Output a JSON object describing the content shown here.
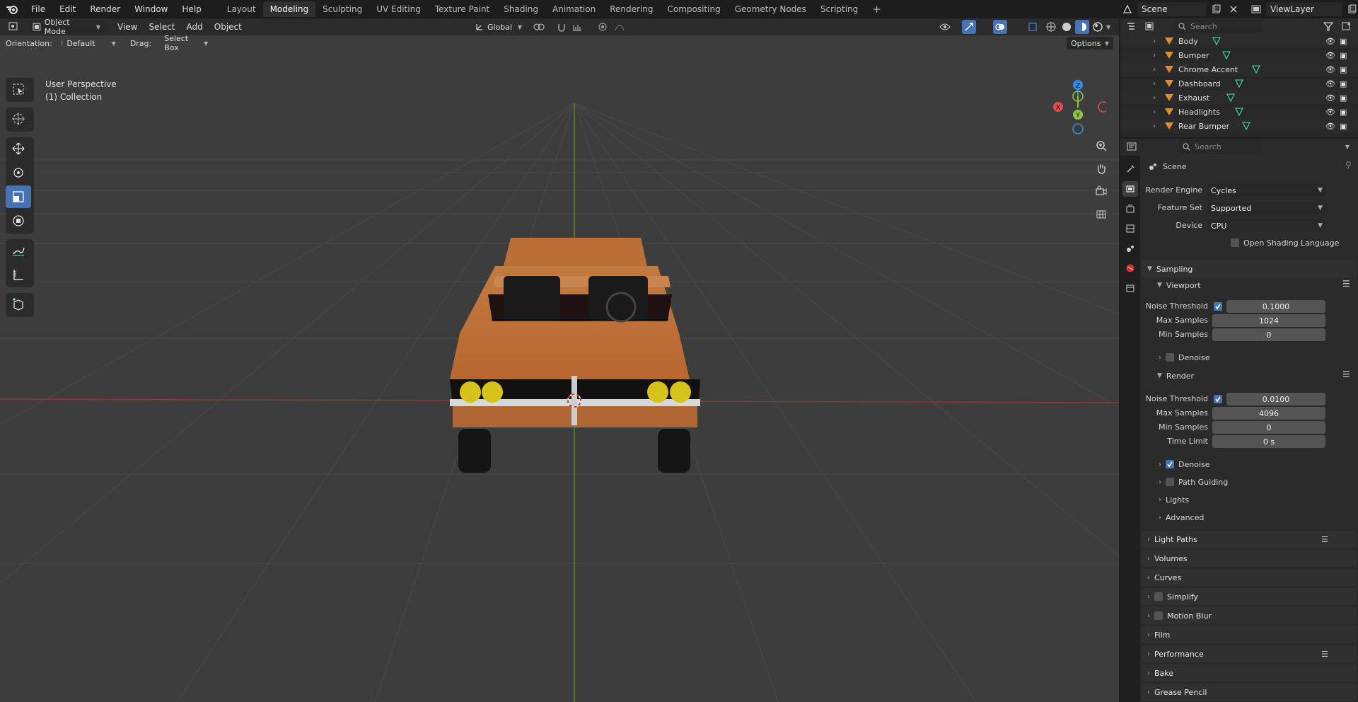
{
  "topbar": {
    "menus": [
      "File",
      "Edit",
      "Render",
      "Window",
      "Help"
    ],
    "workspaces": [
      "Layout",
      "Modeling",
      "Sculpting",
      "UV Editing",
      "Texture Paint",
      "Shading",
      "Animation",
      "Rendering",
      "Compositing",
      "Geometry Nodes",
      "Scripting"
    ],
    "active_workspace": "Modeling",
    "scene": "Scene",
    "view_layer": "ViewLayer"
  },
  "viewport": {
    "mode": "Object Mode",
    "menus": [
      "View",
      "Select",
      "Add",
      "Object"
    ],
    "transform_orientation": "Global",
    "orientation_label": "Orientation:",
    "orientation_value": "Default",
    "drag_label": "Drag:",
    "drag_value": "Select Box",
    "options": "Options",
    "perspective": "User Perspective",
    "collection": "(1) Collection",
    "gizmo": {
      "z": "Z",
      "y": "Y",
      "x": "X"
    }
  },
  "outliner": {
    "search_placeholder": "Search",
    "items": [
      "Body",
      "Bumper",
      "Chrome Accent",
      "Dashboard",
      "Exhaust",
      "Headlights",
      "Rear Bumper"
    ]
  },
  "properties": {
    "search_placeholder": "Search",
    "context": "Scene",
    "render_engine_label": "Render Engine",
    "render_engine": "Cycles",
    "feature_set_label": "Feature Set",
    "feature_set": "Supported",
    "device_label": "Device",
    "device": "CPU",
    "osl_label": "Open Shading Language",
    "sampling": {
      "title": "Sampling",
      "viewport": {
        "title": "Viewport",
        "noise_threshold_label": "Noise Threshold",
        "noise_threshold": "0.1000",
        "max_samples_label": "Max Samples",
        "max_samples": "1024",
        "min_samples_label": "Min Samples",
        "min_samples": "0",
        "denoise_label": "Denoise"
      },
      "render": {
        "title": "Render",
        "noise_threshold_label": "Noise Threshold",
        "noise_threshold": "0.0100",
        "max_samples_label": "Max Samples",
        "max_samples": "4096",
        "min_samples_label": "Min Samples",
        "min_samples": "0",
        "time_limit_label": "Time Limit",
        "time_limit": "0 s",
        "denoise_label": "Denoise",
        "path_guiding_label": "Path Guiding"
      },
      "lights": "Lights",
      "advanced": "Advanced"
    },
    "panels": [
      "Light Paths",
      "Volumes",
      "Curves",
      "Simplify",
      "Motion Blur",
      "Film",
      "Performance",
      "Bake",
      "Grease Pencil"
    ]
  },
  "colors": {
    "accent": "#4772b3",
    "axis_x": "#e34d4d",
    "axis_y": "#8ec63f",
    "axis_z": "#3c8ae0",
    "car_body": "#c77a3e"
  }
}
